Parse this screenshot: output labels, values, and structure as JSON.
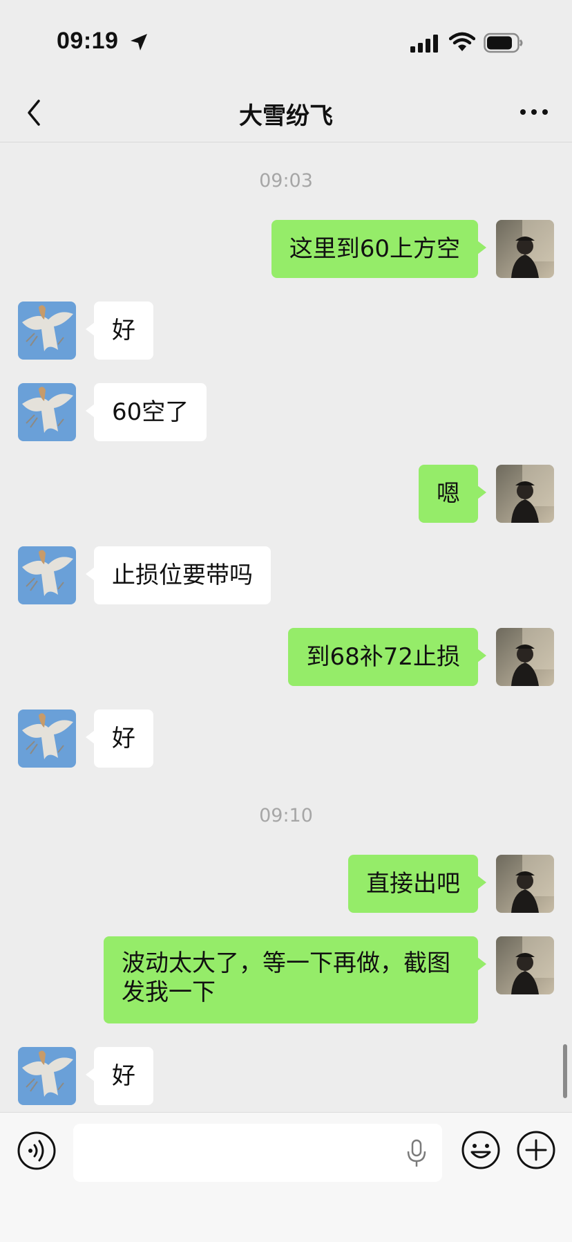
{
  "status_bar": {
    "time": "09:19",
    "icons": [
      "location-arrow-icon",
      "cellular-signal-icon",
      "wifi-icon",
      "battery-icon"
    ]
  },
  "nav": {
    "title": "大雪纷飞",
    "back_icon": "chevron-left-icon",
    "more_icon": "more-dots-icon"
  },
  "messages": [
    {
      "type": "timestamp",
      "text": "09:03"
    },
    {
      "type": "msg",
      "from": "me",
      "text": "这里到60上方空"
    },
    {
      "type": "msg",
      "from": "peer",
      "text": "好"
    },
    {
      "type": "msg",
      "from": "peer",
      "text": "60空了"
    },
    {
      "type": "msg",
      "from": "me",
      "text": "嗯"
    },
    {
      "type": "msg",
      "from": "peer",
      "text": "止损位要带吗"
    },
    {
      "type": "msg",
      "from": "me",
      "text": "到68补72止损"
    },
    {
      "type": "msg",
      "from": "peer",
      "text": "好"
    },
    {
      "type": "timestamp",
      "text": "09:10"
    },
    {
      "type": "msg",
      "from": "me",
      "text": "直接出吧"
    },
    {
      "type": "msg",
      "from": "me",
      "text": "波动太大了，等一下再做，截图发我一下"
    },
    {
      "type": "msg",
      "from": "peer",
      "text": "好"
    }
  ],
  "input_bar": {
    "voice_icon": "voice-icon",
    "input_value": "",
    "mic_icon": "mic-icon",
    "emoji_icon": "emoji-icon",
    "plus_icon": "plus-icon"
  },
  "colors": {
    "background": "#ededed",
    "my_bubble": "#95ec69",
    "peer_bubble": "#ffffff",
    "timestamp": "#a6a6a6"
  }
}
